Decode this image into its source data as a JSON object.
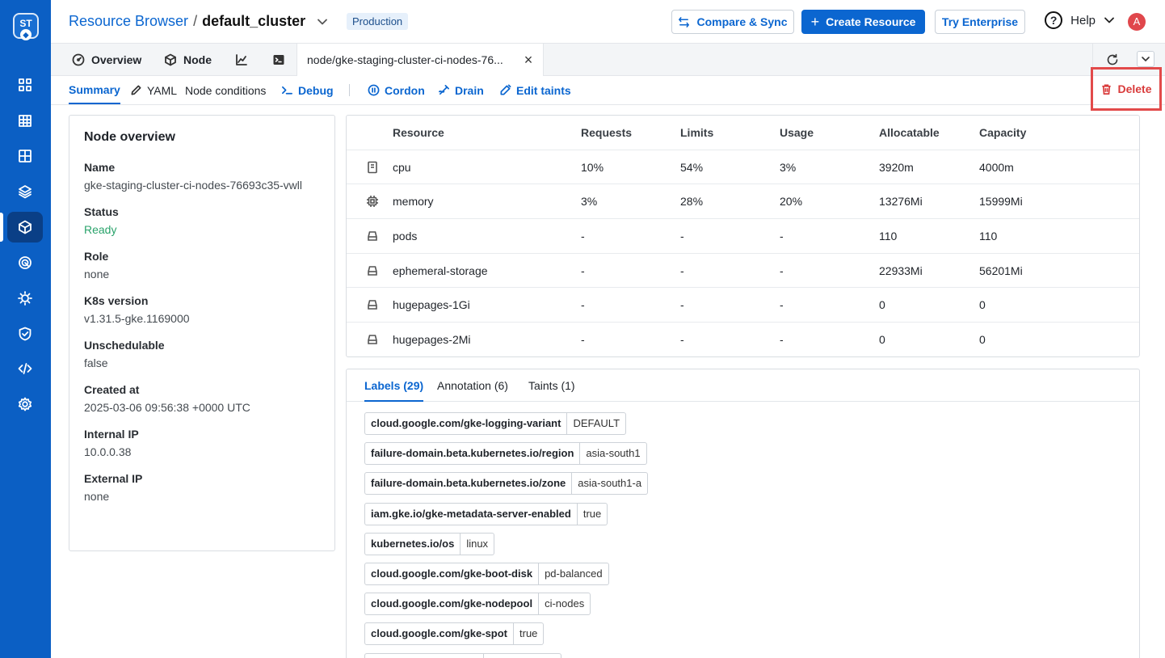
{
  "rail": {
    "logo_text": "ST",
    "items": [
      "apps-icon",
      "grid-icon",
      "cluster-grid-icon",
      "stack-icon",
      "cube-icon",
      "target-icon",
      "bug-icon",
      "shield-icon",
      "code-icon",
      "settings-icon"
    ]
  },
  "header": {
    "breadcrumb_link": "Resource Browser",
    "breadcrumb_sep": "/",
    "cluster": "default_cluster",
    "env_badge": "Production",
    "compare_label": "Compare & Sync",
    "create_label": "Create Resource",
    "enterprise_label": "Try Enterprise",
    "help_label": "Help",
    "avatar_initial": "A"
  },
  "tabs": {
    "overview": "Overview",
    "node": "Node",
    "active_tab": "node/gke-staging-cluster-ci-nodes-76...",
    "close": "×"
  },
  "actions": {
    "summary": "Summary",
    "yaml": "YAML",
    "node_conditions": "Node conditions",
    "debug": "Debug",
    "cordon": "Cordon",
    "drain": "Drain",
    "edit_taints": "Edit taints",
    "delete": "Delete"
  },
  "overview": {
    "title": "Node overview",
    "fields": [
      {
        "k": "Name",
        "v": "gke-staging-cluster-ci-nodes-76693c35-vwll"
      },
      {
        "k": "Status",
        "v": "Ready"
      },
      {
        "k": "Role",
        "v": "none"
      },
      {
        "k": "K8s version",
        "v": "v1.31.5-gke.1169000"
      },
      {
        "k": "Unschedulable",
        "v": "false"
      },
      {
        "k": "Created at",
        "v": "2025-03-06 09:56:38 +0000 UTC"
      },
      {
        "k": "Internal IP",
        "v": "10.0.0.38"
      },
      {
        "k": "External IP",
        "v": "none"
      }
    ]
  },
  "resources": {
    "headers": [
      "Resource",
      "Requests",
      "Limits",
      "Usage",
      "Allocatable",
      "Capacity"
    ],
    "rows": [
      {
        "icon": "cpu-icon",
        "name": "cpu",
        "requests": "10%",
        "limits": "54%",
        "usage": "3%",
        "allocatable": "3920m",
        "capacity": "4000m"
      },
      {
        "icon": "memory-icon",
        "name": "memory",
        "requests": "3%",
        "limits": "28%",
        "usage": "20%",
        "allocatable": "13276Mi",
        "capacity": "15999Mi"
      },
      {
        "icon": "drive-icon",
        "name": "pods",
        "requests": "-",
        "limits": "-",
        "usage": "-",
        "allocatable": "110",
        "capacity": "110"
      },
      {
        "icon": "drive-icon",
        "name": "ephemeral-storage",
        "requests": "-",
        "limits": "-",
        "usage": "-",
        "allocatable": "22933Mi",
        "capacity": "56201Mi"
      },
      {
        "icon": "drive-icon",
        "name": "hugepages-1Gi",
        "requests": "-",
        "limits": "-",
        "usage": "-",
        "allocatable": "0",
        "capacity": "0"
      },
      {
        "icon": "drive-icon",
        "name": "hugepages-2Mi",
        "requests": "-",
        "limits": "-",
        "usage": "-",
        "allocatable": "0",
        "capacity": "0"
      }
    ]
  },
  "labels_panel": {
    "tabs": [
      "Labels (29)",
      "Annotation (6)",
      "Taints (1)"
    ],
    "labels": [
      {
        "key": "cloud.google.com/gke-logging-variant",
        "value": "DEFAULT"
      },
      {
        "key": "failure-domain.beta.kubernetes.io/region",
        "value": "asia-south1"
      },
      {
        "key": "failure-domain.beta.kubernetes.io/zone",
        "value": "asia-south1-a"
      },
      {
        "key": "iam.gke.io/gke-metadata-server-enabled",
        "value": "true"
      },
      {
        "key": "kubernetes.io/os",
        "value": "linux"
      },
      {
        "key": "cloud.google.com/gke-boot-disk",
        "value": "pd-balanced"
      },
      {
        "key": "cloud.google.com/gke-nodepool",
        "value": "ci-nodes"
      },
      {
        "key": "cloud.google.com/gke-spot",
        "value": "true"
      }
    ]
  },
  "colors": {
    "rail": "#0b5fc4",
    "accent": "#0b66d0",
    "ready": "#2aa36b",
    "danger": "#d93b3b"
  }
}
